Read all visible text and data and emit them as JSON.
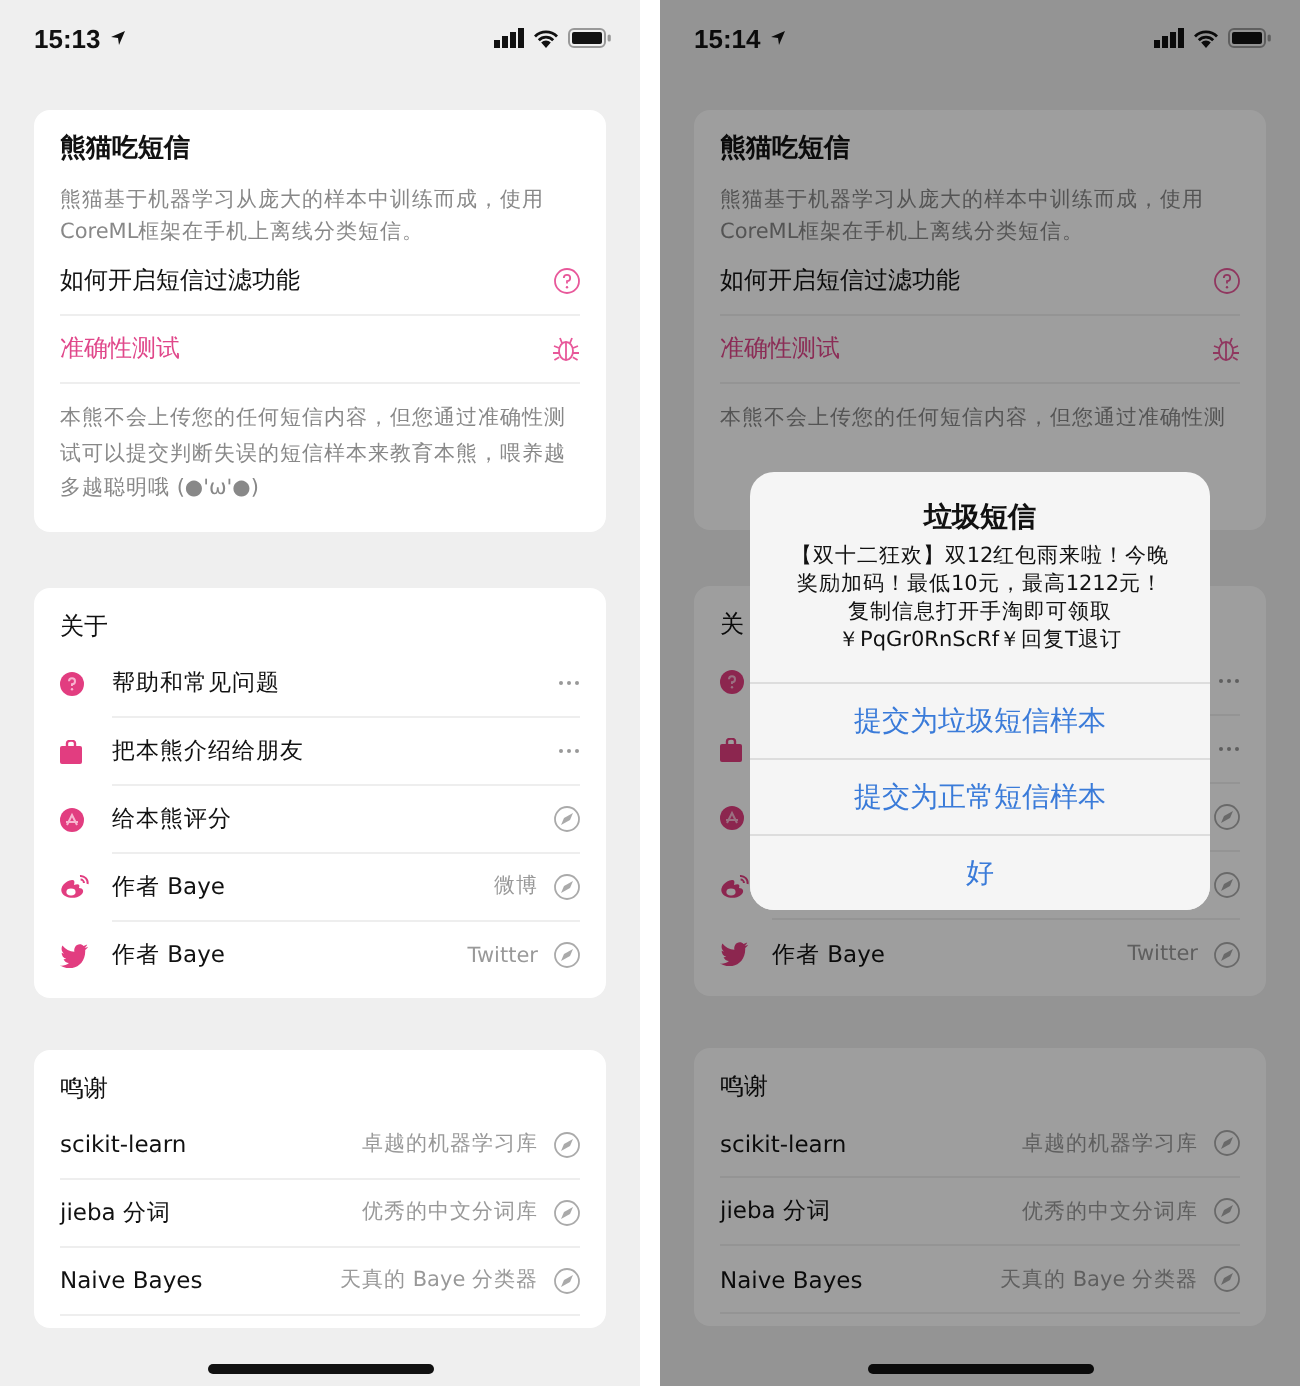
{
  "screens": [
    {
      "dimmed": false,
      "status_bar": {
        "time": "15:13"
      },
      "intro": {
        "title": "熊猫吃短信",
        "description": "熊猫基于机器学习从庞大的样本中训练而成，使用CoreML框架在手机上离线分类短信。",
        "rows": [
          {
            "label": "如何开启短信过滤功能",
            "kind": "help"
          },
          {
            "label": "准确性测试",
            "kind": "test"
          }
        ],
        "note": "本熊不会上传您的任何短信内容，但您通过准确性测试可以提交判断失误的短信样本来教育本熊，喂养越多越聪明哦 (●'ω'●)"
      },
      "about": {
        "title": "关于",
        "rows": [
          {
            "label": "帮助和常见问题",
            "kind": "more"
          },
          {
            "label": "把本熊介绍给朋友",
            "kind": "more"
          },
          {
            "label": "给本熊评分",
            "kind": "link"
          },
          {
            "label": "作者 Baye",
            "value": "微博",
            "kind": "link"
          },
          {
            "label": "作者 Baye",
            "value": "Twitter",
            "kind": "link"
          }
        ]
      },
      "thanks": {
        "title": "鸣谢",
        "rows": [
          {
            "label": "scikit-learn",
            "value": "卓越的机器学习库"
          },
          {
            "label": "jieba 分词",
            "value": "优秀的中文分词库"
          },
          {
            "label": "Naive Bayes",
            "value": "天真的 Baye 分类器"
          }
        ]
      }
    },
    {
      "dimmed": true,
      "status_bar": {
        "time": "15:14"
      },
      "intro": {
        "title": "熊猫吃短信",
        "description": "熊猫基于机器学习从庞大的样本中训练而成，使用CoreML框架在手机上离线分类短信。",
        "rows": [
          {
            "label": "如何开启短信过滤功能",
            "kind": "help"
          },
          {
            "label": "准确性测试",
            "kind": "test"
          }
        ],
        "note": "本熊不会上传您的任何短信内容，但您通过准确性测"
      },
      "about": {
        "title": "关",
        "rows": [
          {
            "kind": "more"
          },
          {
            "kind": "more"
          },
          {
            "kind": "link"
          },
          {
            "kind": "link"
          },
          {
            "label": "作者 Baye",
            "value": "Twitter",
            "kind": "link"
          }
        ]
      },
      "thanks": {
        "title": "鸣谢",
        "rows": [
          {
            "label": "scikit-learn",
            "value": "卓越的机器学习库"
          },
          {
            "label": "jieba 分词",
            "value": "优秀的中文分词库"
          },
          {
            "label": "Naive Bayes",
            "value": "天真的 Baye 分类器"
          }
        ]
      },
      "alert": {
        "title": "垃圾短信",
        "message": "【双十二狂欢】双12红包雨来啦！今晚奖励加码！最低10元，最高1212元！复制信息打开手淘即可领取￥PqGr0RnScRf￥回复T退订",
        "buttons": [
          {
            "label": "提交为垃圾短信样本",
            "kind": "action"
          },
          {
            "label": "提交为正常短信样本",
            "kind": "action"
          },
          {
            "label": "好",
            "kind": "cancel"
          }
        ]
      }
    }
  ]
}
